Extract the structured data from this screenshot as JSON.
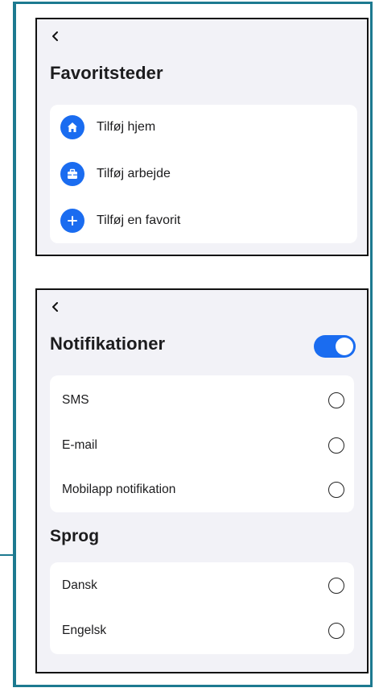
{
  "favorites": {
    "title": "Favoritsteder",
    "items": [
      {
        "label": "Tilføj hjem",
        "icon": "home-icon"
      },
      {
        "label": "Tilføj arbejde",
        "icon": "briefcase-icon"
      },
      {
        "label": "Tilføj en favorit",
        "icon": "plus-icon"
      }
    ]
  },
  "notifications": {
    "title": "Notifikationer",
    "enabled": true,
    "options": [
      {
        "label": "SMS",
        "selected": false
      },
      {
        "label": "E-mail",
        "selected": false
      },
      {
        "label": "Mobilapp notifikation",
        "selected": false
      }
    ]
  },
  "language": {
    "title": "Sprog",
    "options": [
      {
        "label": "Dansk",
        "selected": false
      },
      {
        "label": "Engelsk",
        "selected": false
      }
    ]
  },
  "colors": {
    "accent": "#1a6cf0",
    "frame": "#1d7a90",
    "panel_bg": "#f2f2f7",
    "card_bg": "#ffffff"
  }
}
